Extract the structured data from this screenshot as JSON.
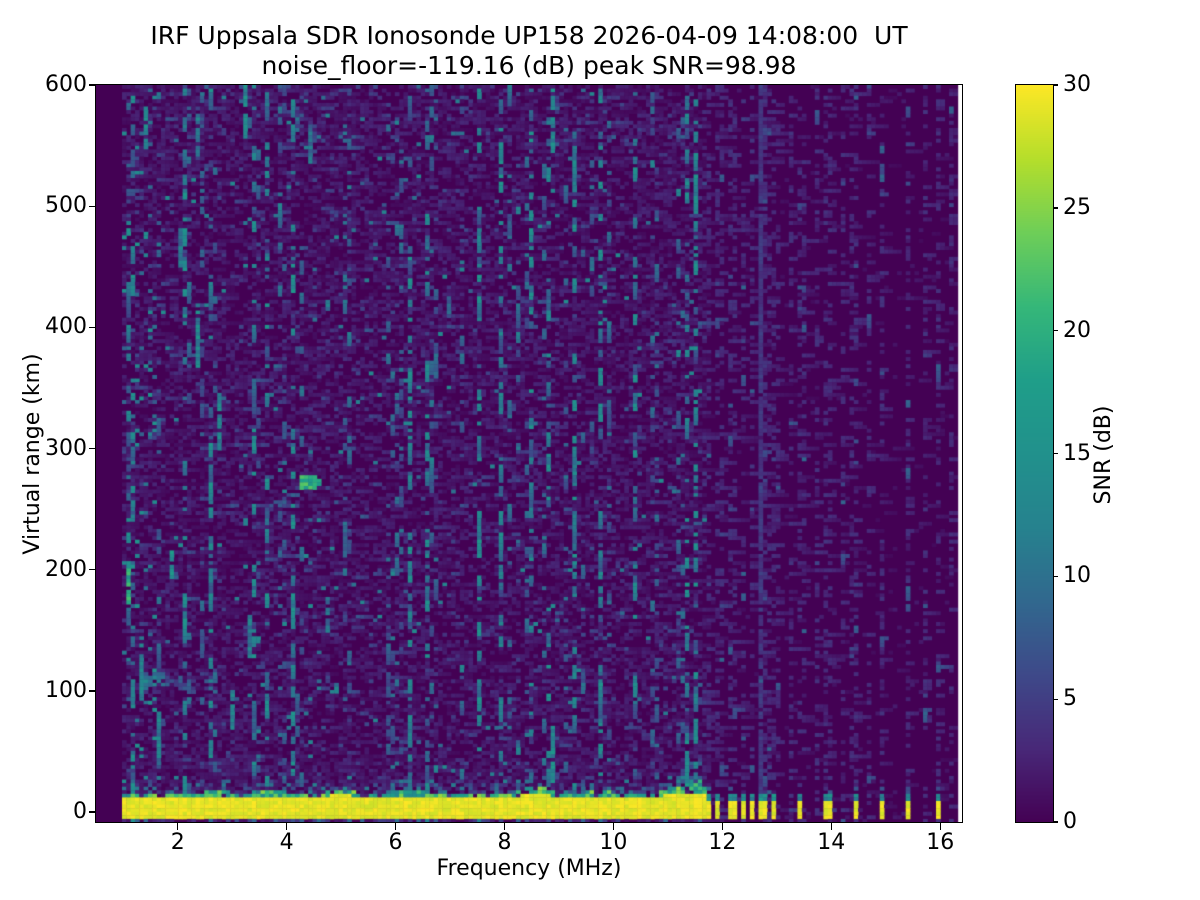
{
  "chart": {
    "title": "IRF Uppsala SDR Ionosonde UP158 2026-04-09 14:08:00  UT",
    "subtitle": "noise_floor=-119.16 (dB) peak SNR=98.98",
    "xlabel": "Frequency (MHz)",
    "ylabel": "Virtual range (km)",
    "colorbar_label": "SNR (dB)"
  },
  "chart_data": {
    "type": "heatmap",
    "title": "IRF Uppsala SDR Ionosonde UP158 2026-04-09 14:08:00  UT",
    "subtitle": "noise_floor=-119.16 (dB) peak SNR=98.98",
    "station": "UP158",
    "datetime_ut": "2026-04-09 14:08:00",
    "noise_floor_db": -119.16,
    "peak_snr_db": 98.98,
    "xlabel": "Frequency (MHz)",
    "ylabel": "Virtual range (km)",
    "xlim": [
      0.5,
      16.4
    ],
    "ylim": [
      -8.25,
      600
    ],
    "xticks": [
      2,
      4,
      6,
      8,
      10,
      12,
      14,
      16
    ],
    "yticks": [
      0,
      100,
      200,
      300,
      400,
      500,
      600
    ],
    "grid": false,
    "colormap": "viridis",
    "colorbar": {
      "label": "SNR (dB)",
      "ticks": [
        0,
        5,
        10,
        15,
        20,
        25,
        30
      ],
      "vmin": 0,
      "vmax": 30
    },
    "sweep_start_mhz": 0.95,
    "sweep_end_mhz": 16.33,
    "ground_pulse_band": {
      "freq_mhz_span": [
        0.95,
        11.68
      ],
      "range_km_span": [
        -4,
        12
      ],
      "snr_db": 30
    },
    "discrete_pulses_mhz": [
      11.72,
      11.92,
      12.18,
      12.38,
      12.55,
      12.73,
      12.93,
      13.42,
      13.94,
      14.43,
      14.92,
      15.41,
      15.96
    ],
    "echo_features": [
      {
        "type": "blob",
        "freq_mhz": 4.42,
        "range_km": 272,
        "freq_halfwidth_mhz": 0.22,
        "range_halfwidth_km": 7,
        "snr_db": 22
      },
      {
        "type": "trace",
        "freq_mhz_span": [
          3.6,
          4.28
        ],
        "range_km_span": [
          248,
          267
        ],
        "snr_db": 7
      },
      {
        "type": "horizontal",
        "freq_mhz_span": [
          1.3,
          2.32
        ],
        "range_km": 108,
        "range_halfwidth_km": 5,
        "snr_db": 13
      }
    ],
    "rfi_streaks": [
      {
        "freq_mhz": 1.12,
        "range_km": [
          172,
          208
        ],
        "snr_db": 20
      },
      {
        "freq_mhz": 1.35,
        "range_km": [
          95,
          140
        ],
        "snr_db": 13
      },
      {
        "freq_mhz": 1.45,
        "range_km": [
          545,
          582
        ],
        "snr_db": 15
      },
      {
        "freq_mhz": 1.62,
        "range_km": [
          40,
          82
        ],
        "snr_db": 13
      },
      {
        "freq_mhz": 1.92,
        "range_km": [
          192,
          222
        ],
        "snr_db": 17
      },
      {
        "freq_mhz": 2.08,
        "range_km": [
          448,
          482
        ],
        "snr_db": 12
      },
      {
        "freq_mhz": 2.35,
        "range_km": [
          368,
          420
        ],
        "snr_db": 15
      },
      {
        "freq_mhz": 2.35,
        "range_km": [
          540,
          576
        ],
        "snr_db": 13
      },
      {
        "freq_mhz": 2.62,
        "range_km": [
          188,
          214
        ],
        "snr_db": 12
      },
      {
        "freq_mhz": 2.78,
        "range_km": [
          298,
          346
        ],
        "snr_db": 14
      },
      {
        "freq_mhz": 3.02,
        "range_km": [
          68,
          102
        ],
        "snr_db": 13
      },
      {
        "freq_mhz": 3.25,
        "range_km": [
          556,
          600
        ],
        "snr_db": 15
      },
      {
        "freq_mhz": 3.3,
        "range_km": [
          128,
          162
        ],
        "snr_db": 12
      },
      {
        "freq_mhz": 4.45,
        "range_km": [
          536,
          568
        ],
        "snr_db": 11
      },
      {
        "freq_mhz": 4.75,
        "range_km": [
          148,
          178
        ],
        "snr_db": 11
      },
      {
        "freq_mhz": 5.1,
        "range_km": [
          210,
          240
        ],
        "snr_db": 10
      },
      {
        "freq_mhz": 6.3,
        "range_km": [
          150,
          180
        ],
        "snr_db": 9
      },
      {
        "freq_mhz": 7.0,
        "range_km": [
          395,
          425
        ],
        "snr_db": 9
      },
      {
        "freq_mhz": 8.87,
        "range_km": [
          545,
          598
        ],
        "snr_db": 15
      },
      {
        "freq_mhz": 8.87,
        "range_km": [
          25,
          75
        ],
        "snr_db": 15
      },
      {
        "freq_mhz": 9.8,
        "range_km": [
          92,
          120
        ],
        "snr_db": 11
      },
      {
        "freq_mhz": 12.73,
        "range_km": [
          0,
          600
        ],
        "snr_db": 5
      }
    ]
  }
}
